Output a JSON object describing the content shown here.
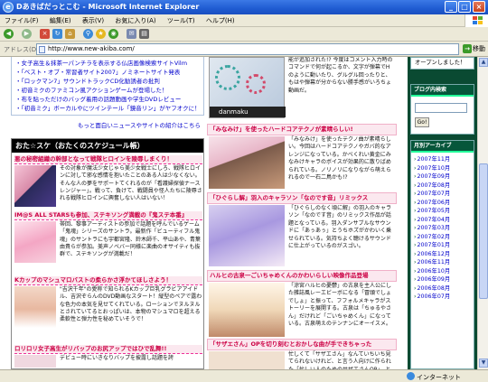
{
  "window": {
    "title": "Dあきばだっとこむ - Microsoft Internet Explorer",
    "min_label": "_",
    "max_label": "□",
    "close_label": "×"
  },
  "menu": {
    "items": [
      "ファイル(F)",
      "編集(E)",
      "表示(V)",
      "お気に入り(A)",
      "ツール(T)",
      "ヘルプ(H)"
    ]
  },
  "toolbar": {
    "back_icon": "back-arrow-icon",
    "forward_icon": "forward-arrow-icon"
  },
  "address": {
    "label": "アドレス(D)",
    "url": "http://www.new-akiba.com/",
    "go_label": "移動"
  },
  "left": {
    "links": [
      "・女子高生＆抹茶一パンチラを表示する仏店画像検索サイトVilm",
      "・「ベスト・オブ・常習者サイト2007」ノミネートサイト発表",
      "・「ロックマン7」サウンドトラックCD化勧誘者の批判",
      "・初音ミクのファミコン風アクションゲームが登場した！",
      "・布を貼っただけのバッグ着用の話題動画や学生DVDレビュー",
      "・「初音ミク」ボーカルやにツインテール「鏡音リン」がヤフオクに！"
    ],
    "more_link": "もっと面白いニュースやサイトの紹介はこちら",
    "schedule_title": "おた☆スケ（おたくのスケジュール帳）",
    "entries": [
      {
        "title": "悪の秘密組織の幹部となって戦隊ヒロインを陵辱しまくり！",
        "text": "その対象が魔法少女じゃら美少女戦士にしろ、戦隊ヒロインに対して邪な感情を抱いたことのある人は少なくない。そんな人の夢をサポートてくれるのが「看護婦探偵ナースレンジャー」。戦って、負けて、戦闘員や怪人たちに陵辱される戦隊ヒロインに興奮しない人はいない！"
      },
      {
        "title": "IM@S ALL STARSも参加、ステキソング満載の『鬼ステ本番』",
        "text": "帯回、黎事アーティストの参加で話題を呼んでいるゲーム「鬼魂」シリーズのサントラ。最新作「ビューティフル鬼魂」のサントラにも宇都宮隆、鈴木師千、平山あや、青葉由貴らが参加。美声ノベバー同様に楽曲のオサイティも抜群で、ステキソングが満載だ！"
      },
      {
        "title": "Kカップのマシュマロバストの柔らかさ浮かてほしさよう！",
        "text": "\"吉沢千年\"の愛称で知られるKカップ巨乳グラビアアイドル、吉沢ぞらんのDVD動画なスタート！縦型のペアで露わな色力の本気を見せてくれている。ローションでヌルヌルとされていてるとおっぱいは、本物のマシュマロを超える柔軟性と弾力性を秘めていそうで！"
      },
      {
        "title": "ロリロリ女子高生がリバップのお尻アップではひで乱舞!!",
        "text": "デビュー時にいきなりバップを披露し話題を誇"
      }
    ]
  },
  "middle": {
    "top_text": "能が追加された!? 今度はコメント入力時のコマンドで何が起こるか、文字が弾幕でHのように動いたり、グルグル回ったりと、もはや弾幕が分からない勝手感がいろちょ動画だ。",
    "danmaku_label": "danmaku",
    "entries": [
      {
        "title": "「みなみけ」を使ったハードコアテクノが素晴らしい!",
        "text": "「みなみけ」を使ったテクノ曲が素晴らしい。今回はハードコアテクノやガバ的なアレンジになっている。かべくれい黄金にみなみけキャラのボイスが効果的に散りばめられている。ノリノリになりながら萌えられるので一石二鳥かも!?"
      },
      {
        "title": "「ひぐらし解」羽入のキャラソン「なのです音」リミックス",
        "text": "「ひぐらしのなく頃に解」の羽入のキャラソン「なのです音」のリミックス作品が話題となっている。羽入ダンサブルなサウンドに「あぅあぅ」とうちホズがかわいく乗せられている。気持ちよく聴けるサウンドに仕上がっているのがスゴい。"
      },
      {
        "title": "ハルヒの古泉一ごいちゃめくんのかわいらしい映像作品登場",
        "text": "「涼宮ハルヒの憂鬱」の古泉を主人公にした雑誌風レーエビーボになる「冒頭でしょでしょ」と振って、フフォルメキャラがストーリーを展開する。古泉は「ちゅるやさん」だけれど「ごいちゃめくん」になっている。古泉萌えのテンナンにオーイスメ。"
      },
      {
        "title": "「サザエさん」OPを切り刻むとおかしな曲が手できちゃった",
        "text": "忙しくて「サザエさん」なんていちいち見てられないけれど、と言う人向けに作られた「忙しい人のためのサザエさんOP」。とにかく"
      }
    ]
  },
  "right": {
    "top_label": "オープンしました！",
    "search_title": "ブログ内検索",
    "search_button": "Go!",
    "archive_title": "月別アーカイブ",
    "archives": [
      "2007年11月",
      "2007年10月",
      "2007年09月",
      "2007年08月",
      "2007年07月",
      "2007年06月",
      "2007年05月",
      "2007年04月",
      "2007年03月",
      "2007年02月",
      "2007年01月",
      "2006年12月",
      "2006年11月",
      "2006年10月",
      "2006年09月",
      "2006年08月",
      "2006年07月"
    ]
  },
  "status": {
    "zone": "インターネット"
  },
  "colors": {
    "title_bar": "#1f5bd1",
    "accent_pink": "#cc0044",
    "sidebar_green": "#0a4a32"
  }
}
